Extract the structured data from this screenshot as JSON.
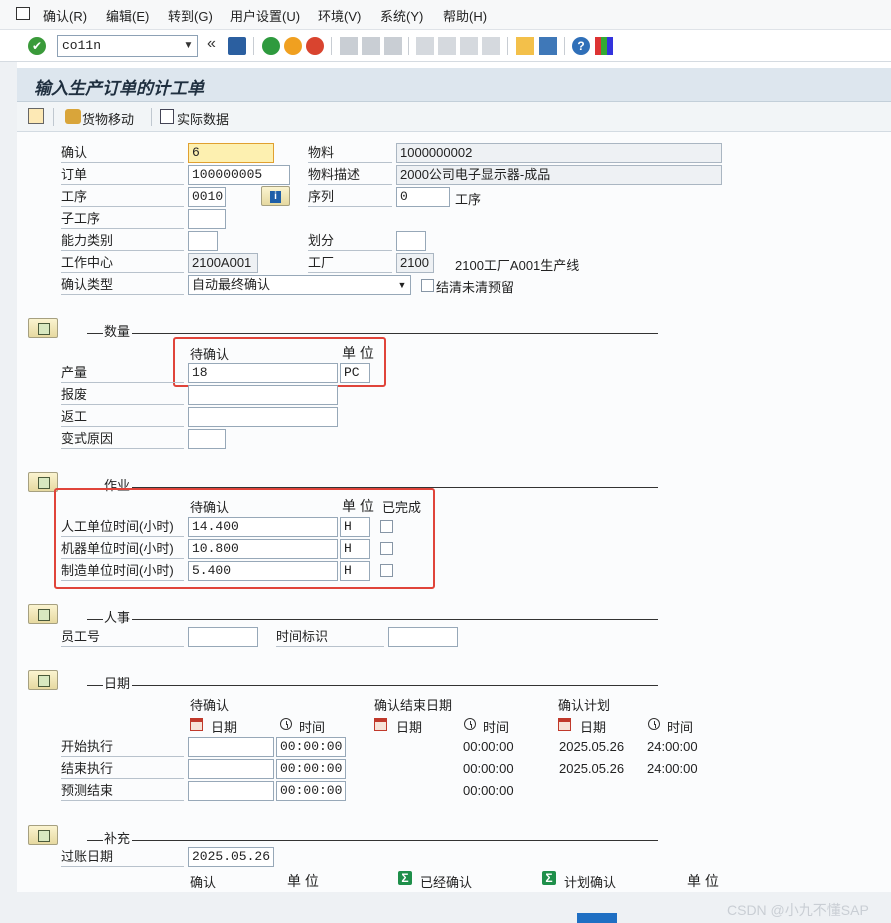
{
  "menu": {
    "items": [
      "确认(R)",
      "编辑(E)",
      "转到(G)",
      "用户设置(U)",
      "环境(V)",
      "系统(Y)",
      "帮助(H)"
    ]
  },
  "toolbar": {
    "command_value": "co11n",
    "collapse_glyph": "«"
  },
  "title": "输入生产订单的计工单",
  "app_toolbar": {
    "goods_movement": "货物移动",
    "actual_data": "实际数据"
  },
  "header": {
    "confirm_label": "确认",
    "confirm_value": "6",
    "order_label": "订单",
    "order_value": "100000005",
    "operation_label": "工序",
    "operation_value": "0010",
    "suboperation_label": "子工序",
    "suboperation_value": "",
    "capacity_label": "能力类别",
    "capacity_value": "",
    "workcenter_label": "工作中心",
    "workcenter_value": "2100A001",
    "conftype_label": "确认类型",
    "conftype_value": "自动最终确认",
    "material_label": "物料",
    "material_value": "1000000002",
    "matdesc_label": "物料描述",
    "matdesc_value": "2000公司电子显示器-成品",
    "sequence_label": "序列",
    "sequence_value": "0",
    "sequence_suffix": "工序",
    "split_label": "划分",
    "split_value": "",
    "plant_label": "工厂",
    "plant_value": "2100",
    "plant_desc": "2100工厂A001生产线",
    "clear_reservations_label": "结清未清预留"
  },
  "quantities": {
    "section_title": "数量",
    "col_pending": "待确认",
    "col_unit": "单 位",
    "yield_label": "产量",
    "yield_value": "18",
    "yield_unit": "PC",
    "scrap_label": "报废",
    "scrap_value": "",
    "rework_label": "返工",
    "rework_value": "",
    "variance_label": "变式原因",
    "variance_value": ""
  },
  "activities": {
    "section_title": "作业",
    "col_pending": "待确认",
    "col_unit": "单 位",
    "col_done": "已完成",
    "rows": [
      {
        "label": "人工单位时间(小时)",
        "value": "14.400",
        "unit": "H"
      },
      {
        "label": "机器单位时间(小时)",
        "value": "10.800",
        "unit": "H"
      },
      {
        "label": "制造单位时间(小时)",
        "value": "5.400",
        "unit": "H"
      }
    ]
  },
  "personnel": {
    "section_title": "人事",
    "employee_label": "员工号",
    "employee_value": "",
    "timeid_label": "时间标识",
    "timeid_value": ""
  },
  "dates": {
    "section_title": "日期",
    "col_pending": "待确认",
    "col_confirmed_end": "确认结束日期",
    "col_plan": "确认计划",
    "date_hdr": "日期",
    "time_hdr": "时间",
    "rows": [
      {
        "label": "开始执行",
        "date": "",
        "time": "00:00:00",
        "conf_time": "00:00:00",
        "plan_date": "2025.05.26",
        "plan_time": "24:00:00"
      },
      {
        "label": "结束执行",
        "date": "",
        "time": "00:00:00",
        "conf_time": "00:00:00",
        "plan_date": "2025.05.26",
        "plan_time": "24:00:00"
      },
      {
        "label": "预测结束",
        "date": "",
        "time": "00:00:00",
        "conf_time": "00:00:00",
        "plan_date": "",
        "plan_time": ""
      }
    ]
  },
  "supplement": {
    "section_title": "补充",
    "posting_date_label": "过账日期",
    "posting_date_value": "2025.05.26",
    "col_confirm": "确认",
    "col_unit": "单 位",
    "col_already": "已经确认",
    "col_plan": "计划确认",
    "col_unit2": "单 位"
  },
  "watermark": "CSDN @小九不懂SAP",
  "colors": {
    "highlight_box": "#e0443a",
    "focus_field": "#fdf0b0",
    "title_bg": "#dde6ee"
  }
}
